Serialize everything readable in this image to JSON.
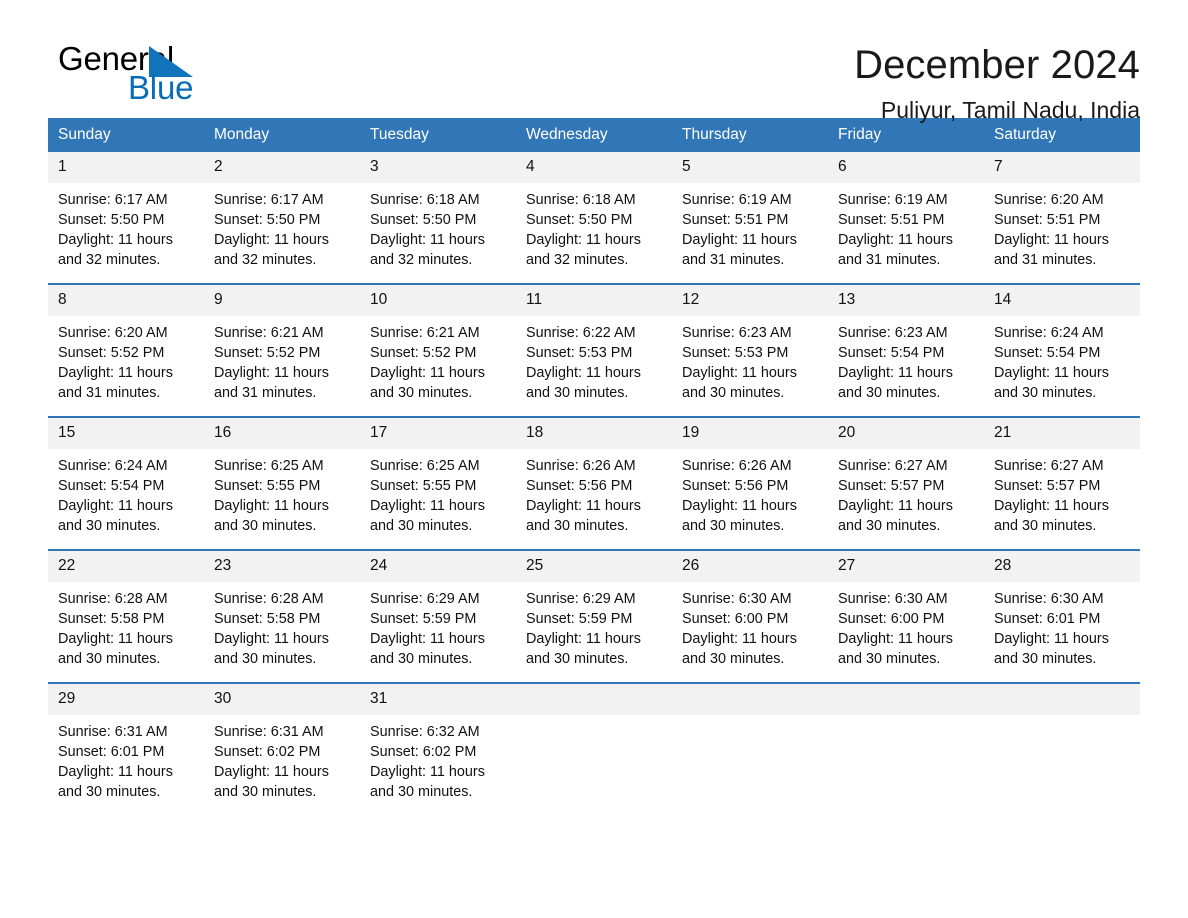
{
  "brand": {
    "word_general": "General",
    "word_blue": "Blue",
    "flag_icon": "triangle-flag-icon"
  },
  "header": {
    "title": "December 2024",
    "location": "Puliyur, Tamil Nadu, India"
  },
  "colors": {
    "header_blue": "#3176b6",
    "row_divider_blue": "#3176b6",
    "daynum_band": "#f2f2f2",
    "brand_blue": "#0a6cb5",
    "text": "#111111"
  },
  "calendar": {
    "weekday_headers": [
      "Sunday",
      "Monday",
      "Tuesday",
      "Wednesday",
      "Thursday",
      "Friday",
      "Saturday"
    ],
    "weeks": [
      [
        {
          "day": "1",
          "info": "Sunrise: 6:17 AM\nSunset: 5:50 PM\nDaylight: 11 hours and 32 minutes."
        },
        {
          "day": "2",
          "info": "Sunrise: 6:17 AM\nSunset: 5:50 PM\nDaylight: 11 hours and 32 minutes."
        },
        {
          "day": "3",
          "info": "Sunrise: 6:18 AM\nSunset: 5:50 PM\nDaylight: 11 hours and 32 minutes."
        },
        {
          "day": "4",
          "info": "Sunrise: 6:18 AM\nSunset: 5:50 PM\nDaylight: 11 hours and 32 minutes."
        },
        {
          "day": "5",
          "info": "Sunrise: 6:19 AM\nSunset: 5:51 PM\nDaylight: 11 hours and 31 minutes."
        },
        {
          "day": "6",
          "info": "Sunrise: 6:19 AM\nSunset: 5:51 PM\nDaylight: 11 hours and 31 minutes."
        },
        {
          "day": "7",
          "info": "Sunrise: 6:20 AM\nSunset: 5:51 PM\nDaylight: 11 hours and 31 minutes."
        }
      ],
      [
        {
          "day": "8",
          "info": "Sunrise: 6:20 AM\nSunset: 5:52 PM\nDaylight: 11 hours and 31 minutes."
        },
        {
          "day": "9",
          "info": "Sunrise: 6:21 AM\nSunset: 5:52 PM\nDaylight: 11 hours and 31 minutes."
        },
        {
          "day": "10",
          "info": "Sunrise: 6:21 AM\nSunset: 5:52 PM\nDaylight: 11 hours and 30 minutes."
        },
        {
          "day": "11",
          "info": "Sunrise: 6:22 AM\nSunset: 5:53 PM\nDaylight: 11 hours and 30 minutes."
        },
        {
          "day": "12",
          "info": "Sunrise: 6:23 AM\nSunset: 5:53 PM\nDaylight: 11 hours and 30 minutes."
        },
        {
          "day": "13",
          "info": "Sunrise: 6:23 AM\nSunset: 5:54 PM\nDaylight: 11 hours and 30 minutes."
        },
        {
          "day": "14",
          "info": "Sunrise: 6:24 AM\nSunset: 5:54 PM\nDaylight: 11 hours and 30 minutes."
        }
      ],
      [
        {
          "day": "15",
          "info": "Sunrise: 6:24 AM\nSunset: 5:54 PM\nDaylight: 11 hours and 30 minutes."
        },
        {
          "day": "16",
          "info": "Sunrise: 6:25 AM\nSunset: 5:55 PM\nDaylight: 11 hours and 30 minutes."
        },
        {
          "day": "17",
          "info": "Sunrise: 6:25 AM\nSunset: 5:55 PM\nDaylight: 11 hours and 30 minutes."
        },
        {
          "day": "18",
          "info": "Sunrise: 6:26 AM\nSunset: 5:56 PM\nDaylight: 11 hours and 30 minutes."
        },
        {
          "day": "19",
          "info": "Sunrise: 6:26 AM\nSunset: 5:56 PM\nDaylight: 11 hours and 30 minutes."
        },
        {
          "day": "20",
          "info": "Sunrise: 6:27 AM\nSunset: 5:57 PM\nDaylight: 11 hours and 30 minutes."
        },
        {
          "day": "21",
          "info": "Sunrise: 6:27 AM\nSunset: 5:57 PM\nDaylight: 11 hours and 30 minutes."
        }
      ],
      [
        {
          "day": "22",
          "info": "Sunrise: 6:28 AM\nSunset: 5:58 PM\nDaylight: 11 hours and 30 minutes."
        },
        {
          "day": "23",
          "info": "Sunrise: 6:28 AM\nSunset: 5:58 PM\nDaylight: 11 hours and 30 minutes."
        },
        {
          "day": "24",
          "info": "Sunrise: 6:29 AM\nSunset: 5:59 PM\nDaylight: 11 hours and 30 minutes."
        },
        {
          "day": "25",
          "info": "Sunrise: 6:29 AM\nSunset: 5:59 PM\nDaylight: 11 hours and 30 minutes."
        },
        {
          "day": "26",
          "info": "Sunrise: 6:30 AM\nSunset: 6:00 PM\nDaylight: 11 hours and 30 minutes."
        },
        {
          "day": "27",
          "info": "Sunrise: 6:30 AM\nSunset: 6:00 PM\nDaylight: 11 hours and 30 minutes."
        },
        {
          "day": "28",
          "info": "Sunrise: 6:30 AM\nSunset: 6:01 PM\nDaylight: 11 hours and 30 minutes."
        }
      ],
      [
        {
          "day": "29",
          "info": "Sunrise: 6:31 AM\nSunset: 6:01 PM\nDaylight: 11 hours and 30 minutes."
        },
        {
          "day": "30",
          "info": "Sunrise: 6:31 AM\nSunset: 6:02 PM\nDaylight: 11 hours and 30 minutes."
        },
        {
          "day": "31",
          "info": "Sunrise: 6:32 AM\nSunset: 6:02 PM\nDaylight: 11 hours and 30 minutes."
        },
        {
          "day": "",
          "info": ""
        },
        {
          "day": "",
          "info": ""
        },
        {
          "day": "",
          "info": ""
        },
        {
          "day": "",
          "info": ""
        }
      ]
    ]
  }
}
